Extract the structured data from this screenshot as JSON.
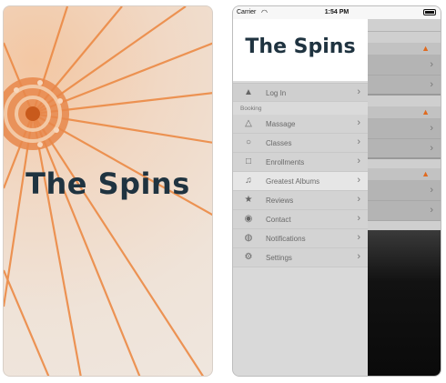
{
  "splash": {
    "title": "The Spins"
  },
  "phone": {
    "status": {
      "carrier": "Carrier",
      "wifi_icon": "wifi-icon",
      "time": "1:54 PM"
    },
    "drawer": {
      "logo": "The Spins",
      "login": {
        "label": "Log In",
        "icon": "warning-triangle-icon"
      },
      "section": "Booking",
      "items": [
        {
          "label": "Massage",
          "icon": "triangle-outline-icon"
        },
        {
          "label": "Classes",
          "icon": "circle-outline-icon"
        },
        {
          "label": "Enrollments",
          "icon": "square-outline-icon"
        },
        {
          "label": "Greatest Albums",
          "icon": "music-note-icon"
        },
        {
          "label": "Reviews",
          "icon": "star-icon"
        },
        {
          "label": "Contact",
          "icon": "location-pin-icon"
        },
        {
          "label": "Notifications",
          "icon": "megaphone-icon"
        },
        {
          "label": "Settings",
          "icon": "gear-icon"
        }
      ]
    },
    "accent": "#e06a1f"
  }
}
